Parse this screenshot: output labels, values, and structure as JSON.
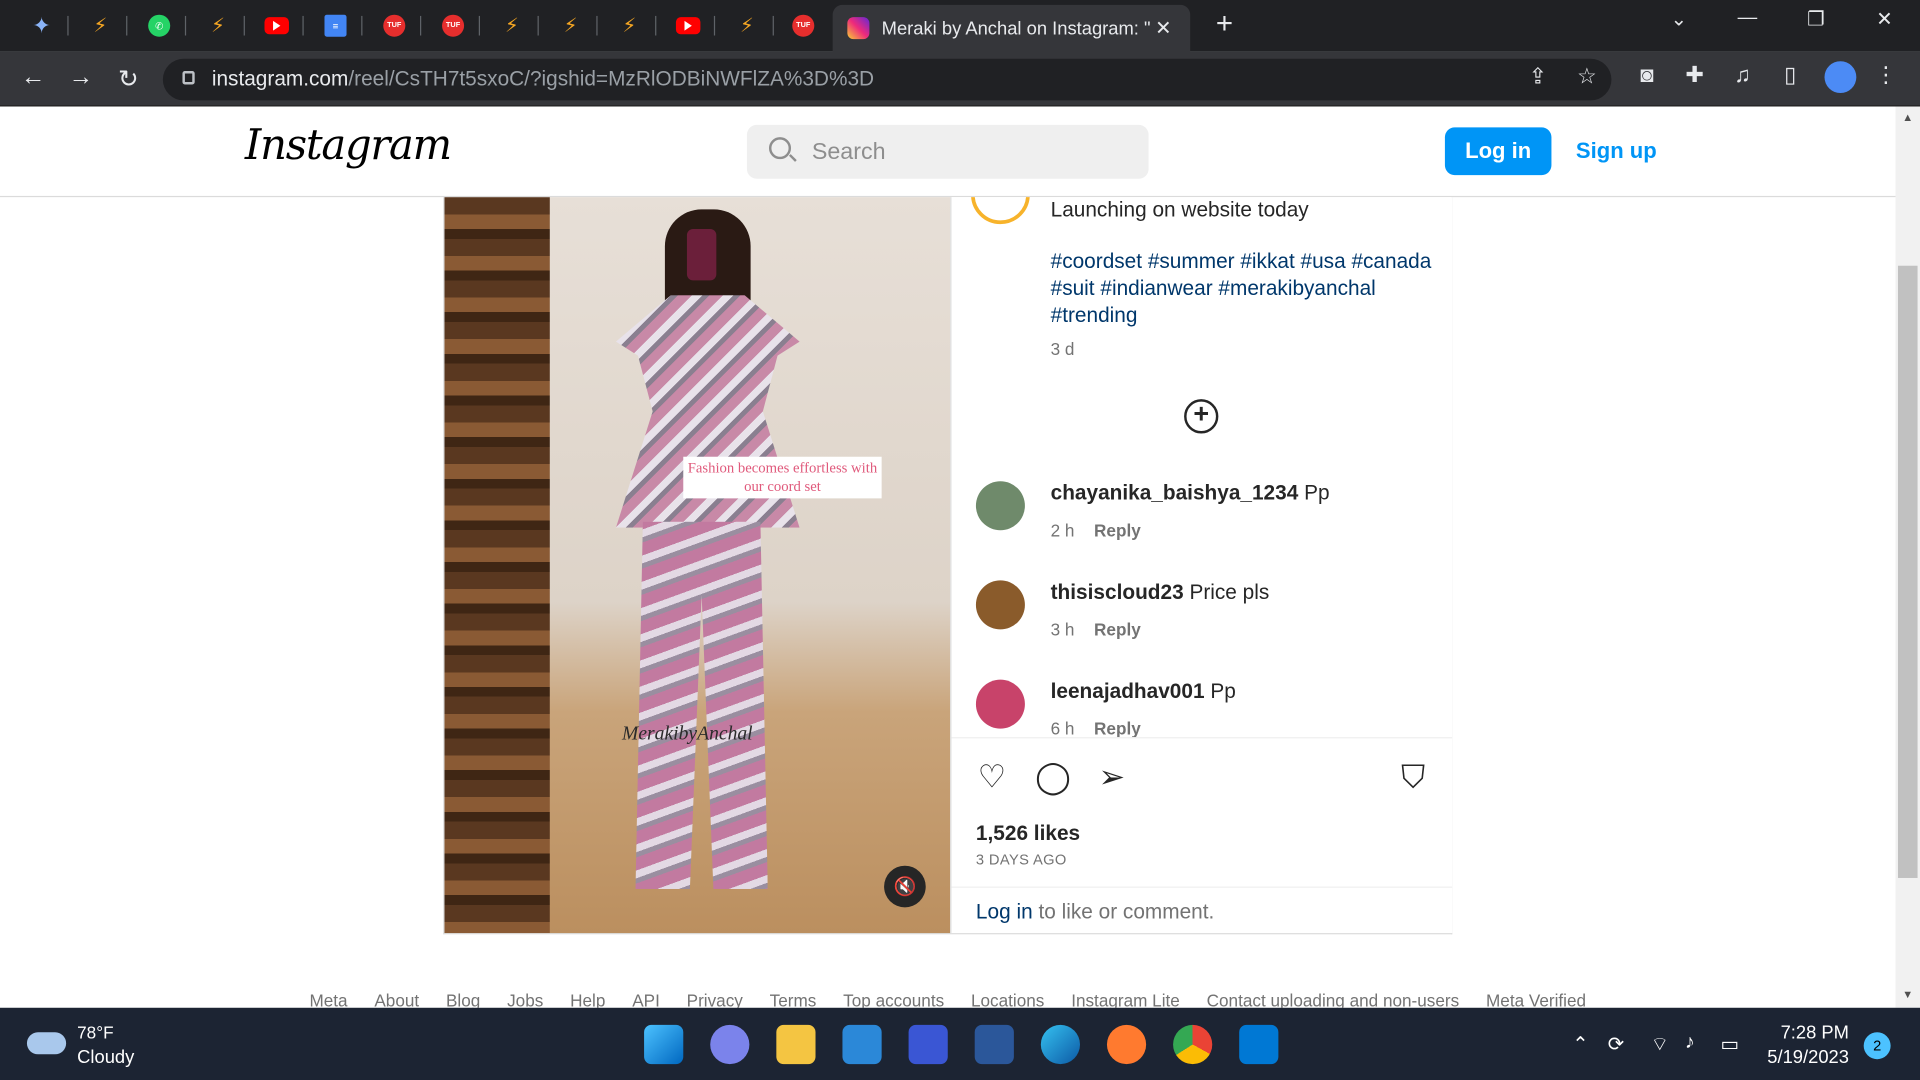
{
  "browser": {
    "active_tab_title": "Meraki by Anchal on Instagram: \"",
    "url_host": "instagram.com",
    "url_path": "/reel/CsTH7t5sxoC/?igshid=MzRlODBiNWFlZA%3D%3D",
    "pinned_tabs": [
      "gemini-icon",
      "sign-icon",
      "whatsapp-icon",
      "sign-icon",
      "youtube-icon",
      "docs-icon",
      "tuf-icon",
      "tuf-icon",
      "sign-icon",
      "sign-icon",
      "sign-icon",
      "youtube-icon",
      "sign-icon",
      "tuf-icon"
    ]
  },
  "instagram": {
    "logo": "Instagram",
    "search_placeholder": "Search",
    "login_label": "Log in",
    "signup_label": "Sign up"
  },
  "post": {
    "media_caption": "Fashion becomes effortless with our coord set",
    "watermark": "MerakibyAnchal",
    "caption_text": "Launching on website today",
    "hashtags": "#coordset #summer #ikkat #usa #canada #suit #indianwear #merakibyanchal #trending",
    "caption_time": "3 d",
    "comments": [
      {
        "user": "chayanika_baishya_1234",
        "text": "Pp",
        "time": "2 h",
        "reply": "Reply",
        "avatar_color": "#6f8a6b"
      },
      {
        "user": "thisiscloud23",
        "text": "Price pls",
        "time": "3 h",
        "reply": "Reply",
        "avatar_color": "#8a5b2b"
      },
      {
        "user": "leenajadhav001",
        "text": "Pp",
        "time": "6 h",
        "reply": "Reply",
        "avatar_color": "#c8436a"
      }
    ],
    "likes": "1,526 likes",
    "posted_ago": "3 DAYS AGO",
    "login_link": "Log in",
    "login_suffix": "to like or comment."
  },
  "footer": {
    "links": [
      "Meta",
      "About",
      "Blog",
      "Jobs",
      "Help",
      "API",
      "Privacy",
      "Terms",
      "Top accounts",
      "Locations",
      "Instagram Lite",
      "Contact uploading and non-users",
      "Meta Verified"
    ]
  },
  "taskbar": {
    "temperature": "78°F",
    "condition": "Cloudy",
    "time": "7:28 PM",
    "date": "5/19/2023",
    "notification_count": "2"
  },
  "colors": {
    "instagram_blue": "#0095f6",
    "link_blue": "#00376b",
    "chrome_dark": "#202124"
  }
}
